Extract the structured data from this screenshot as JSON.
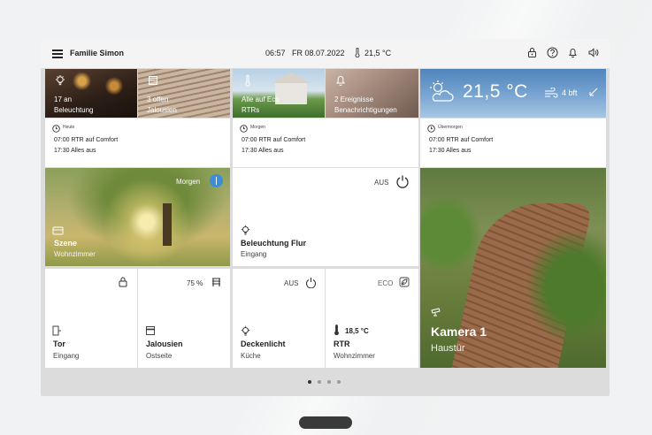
{
  "topbar": {
    "home_name": "Familie Simon",
    "time": "06:57",
    "date": "FR 08.07.2022",
    "temperature": "21,5 °C",
    "icons": [
      "lock-icon",
      "help-icon",
      "bell-icon",
      "speaker-icon"
    ]
  },
  "header_tiles": [
    {
      "value": "17 an",
      "label": "Beleuchtung",
      "icon": "bulb-icon"
    },
    {
      "value": "3 offen",
      "label": "Jalousien",
      "icon": "blind-icon"
    },
    {
      "value": "Alle auf Eco",
      "label": "RTRs",
      "icon": "thermometer-icon"
    },
    {
      "value": "2 Ereignisse",
      "label": "Benachrichtigungen",
      "icon": "bell-icon"
    }
  ],
  "weather": {
    "temperature": "21,5 °C",
    "wind": "4 bft",
    "icon": "partly-cloudy-icon"
  },
  "schedules": [
    {
      "day": "Heute",
      "line1": "07:00 RTR auf Comfort",
      "line2": "17:30 Alles aus"
    },
    {
      "day": "Morgen",
      "line1": "07:00 RTR auf Comfort",
      "line2": "17:30 Alles aus"
    },
    {
      "day": "Übermorgen",
      "line1": "07:00 RTR auf Comfort",
      "line2": "17:30 Alles aus"
    }
  ],
  "scene": {
    "badge": "Morgen",
    "title": "Szene",
    "subtitle": "Wohnzimmer"
  },
  "light_flur": {
    "status": "AUS",
    "title": "Beleuchtung Flur",
    "subtitle": "Eingang"
  },
  "camera": {
    "title": "Kamera 1",
    "subtitle": "Haustür"
  },
  "small_tiles": [
    {
      "status": "",
      "title": "Tor",
      "subtitle": "Eingang"
    },
    {
      "status": "75 %",
      "title": "Jalousien",
      "subtitle": "Ostseite"
    },
    {
      "status": "AUS",
      "title": "Deckenlicht",
      "subtitle": "Küche"
    },
    {
      "status": "ECO",
      "title": "RTR",
      "subtitle": "Wohnzimmer",
      "reading": "18,5 °C"
    }
  ],
  "pager": {
    "pages": 4,
    "active": 1
  },
  "colors": {
    "accent": "#3b8fd8",
    "tile": "#ffffff",
    "gap": "#dcdcdc",
    "topbar": "#f4f4f4"
  }
}
